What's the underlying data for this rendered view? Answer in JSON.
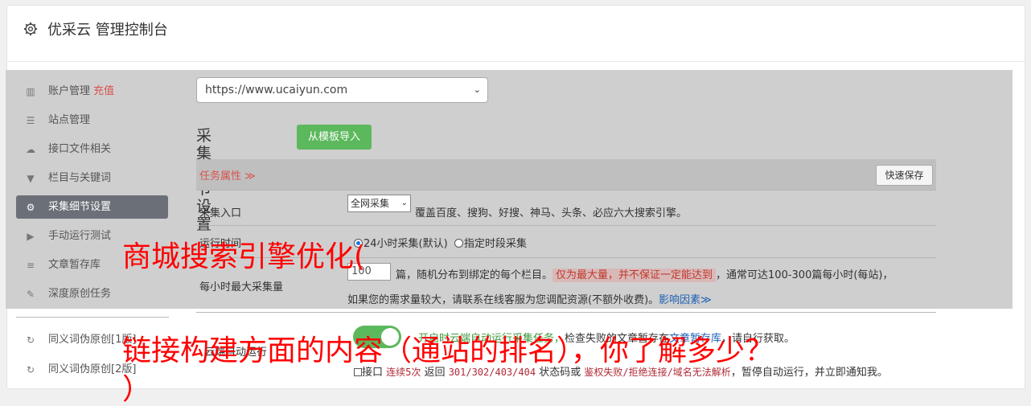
{
  "header": {
    "title": "优采云 管理控制台"
  },
  "sidebar": {
    "items": [
      {
        "label": "账户管理",
        "badge": "充值",
        "icon": "bar-chart-icon"
      },
      {
        "label": "站点管理",
        "icon": "server-icon"
      },
      {
        "label": "接口文件相关",
        "icon": "cloud-upload-icon"
      },
      {
        "label": "栏目与关键词",
        "icon": "filter-icon"
      },
      {
        "label": "采集细节设置",
        "icon": "cogs-icon"
      },
      {
        "label": "手动运行测试",
        "icon": "play-circle-icon"
      },
      {
        "label": "文章暂存库",
        "icon": "database-icon"
      },
      {
        "label": "深度原创任务",
        "icon": "edit-icon"
      },
      {
        "label": "同义词伪原创[1版]",
        "icon": "refresh-icon"
      },
      {
        "label": "同义词伪原创[2版]",
        "icon": "refresh-icon"
      }
    ]
  },
  "main": {
    "site_select": "https://www.ucaiyun.com",
    "section_title": "采集细节设置",
    "template_button": "从模板导入",
    "tab_label": "任务属性 ≫",
    "quick_save": "快速保存",
    "rows": {
      "entry_label": "采集入口",
      "entry_select": "全网采集",
      "entry_desc": "覆盖百度、搜狗、好搜、神马、头条、必应六大搜索引擎。",
      "time_label": "运行时间",
      "time_option_1": "24小时采集(默认)",
      "time_option_2": "指定时段采集",
      "max_label": "每小时最大采集量",
      "max_value": "100",
      "max_text_1": "篇，随机分布到绑定的每个栏目。",
      "max_tag": "仅为最大量，并不保证一定能达到",
      "max_text_2": "，通常可达100-300篇每小时(每站)，",
      "max_text_3": "如果您的需求量较大，请联系在线客服为您调配资源(不额外收费)。",
      "max_link": "影响因素≫",
      "cloud_label": "云端自动运行",
      "cloud_text_1": "开启时云端自动运行采集任务，",
      "cloud_text_2": "检查失败的文章暂存在",
      "cloud_link": "文章暂存库",
      "cloud_text_3": "，请自行获取。",
      "iface_text_1": "接口",
      "iface_tag_1": "连续5次",
      "iface_text_2": "返回",
      "iface_code": "301/302/403/404",
      "iface_text_3": "状态码或",
      "iface_tag_2": "鉴权失败/拒绝连接/域名无法解析",
      "iface_text_4": "，暂停自动运行，并立即通知我。"
    }
  },
  "overlay": {
    "line1": "商城搜索引擎优化(",
    "line2": "链接构建方面的内容（通站的排名），你了解多少？",
    "line3": "）"
  }
}
